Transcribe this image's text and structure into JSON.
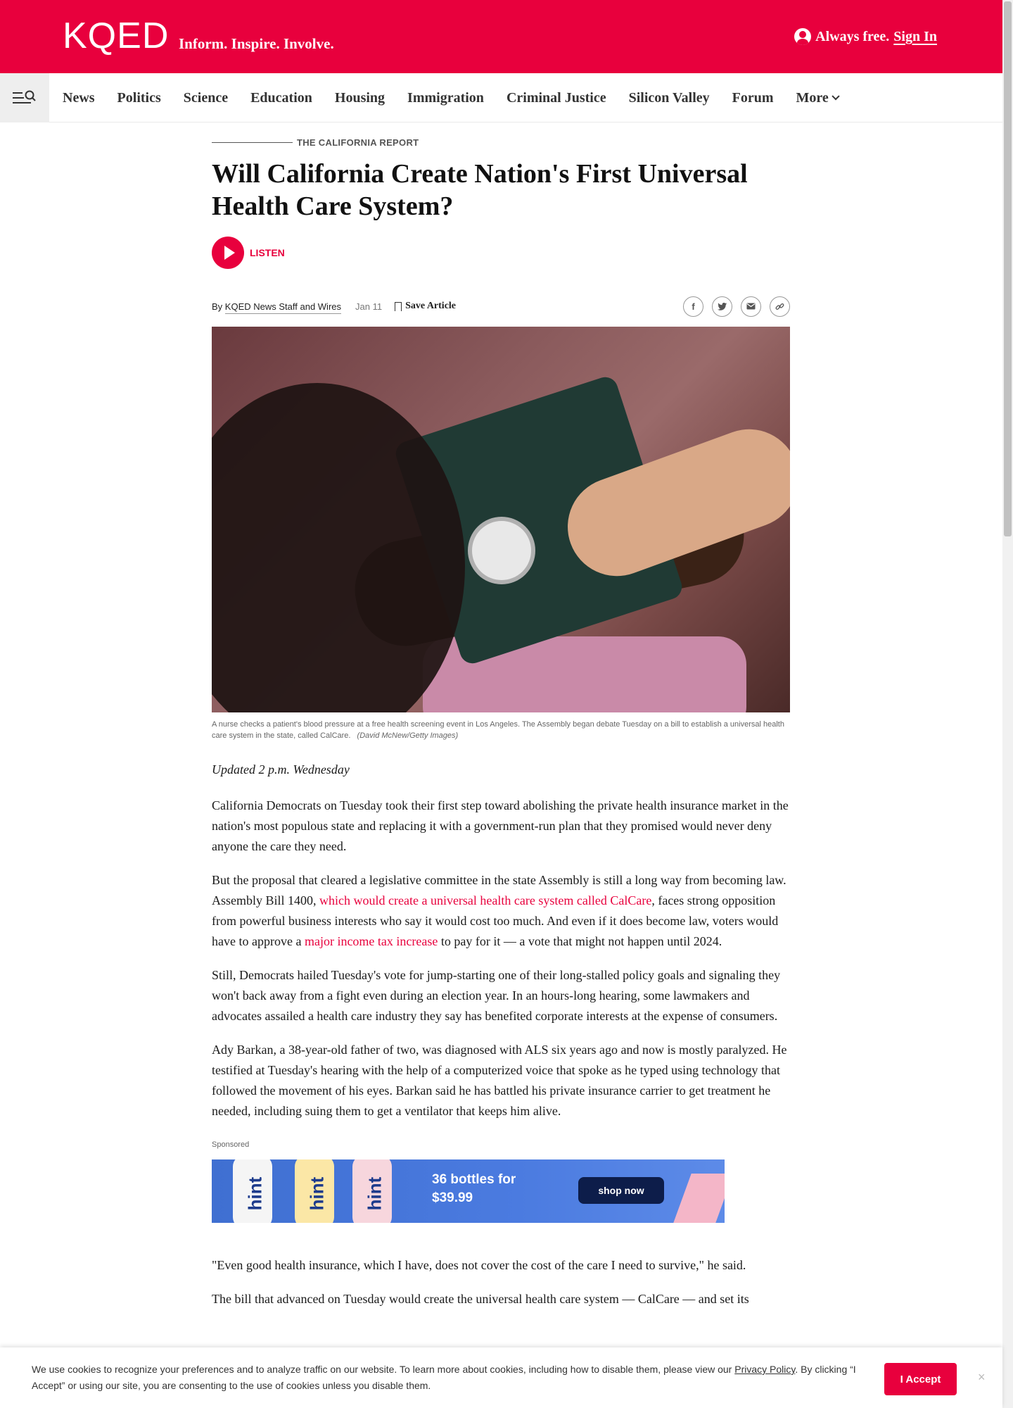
{
  "header": {
    "logo": "KQED",
    "tagline": "Inform. Inspire. Involve.",
    "always_free": "Always free.",
    "sign_in": "Sign In",
    "brand_color": "#e8003d"
  },
  "nav": {
    "items": [
      "News",
      "Politics",
      "Science",
      "Education",
      "Housing",
      "Immigration",
      "Criminal Justice",
      "Silicon Valley",
      "Forum",
      "More"
    ]
  },
  "article": {
    "kicker": "THE CALIFORNIA REPORT",
    "title": "Will California Create Nation's First Universal Health Care System?",
    "listen": "LISTEN",
    "by": "By",
    "author": "KQED News Staff and Wires",
    "date": "Jan 11",
    "save": "Save Article",
    "share_icons": [
      "facebook-icon",
      "twitter-icon",
      "email-icon",
      "link-icon"
    ],
    "caption": "A nurse checks a patient's blood pressure at a free health screening event in Los Angeles. The Assembly began debate Tuesday on a bill to establish a universal health care system in the state, called CalCare.",
    "credit": "(David McNew/Getty Images)",
    "updated": "Updated 2 p.m. Wednesday",
    "p1": "California Democrats on Tuesday took their first step toward abolishing the private health insurance market in the nation's most populous state and replacing it with a government-run plan that they promised would never deny anyone the care they need.",
    "p2_a": "But the proposal that cleared a legislative committee in the state Assembly is still a long way from becoming law. Assembly Bill 1400, ",
    "p2_link1": "which would create a universal health care system called CalCare",
    "p2_b": ", faces strong opposition from powerful business interests who say it would cost too much. And even if it does become law, voters would have to approve a ",
    "p2_link2": "major income tax increase",
    "p2_c": " to pay for it — a vote that might not happen until 2024.",
    "p3": "Still, Democrats hailed Tuesday's vote for jump-starting one of their long-stalled policy goals and signaling they won't back away from a fight even during an election year. In an hours-long hearing, some lawmakers and advocates assailed a health care industry they say has benefited corporate interests at the expense of consumers.",
    "p4": "Ady Barkan, a 38-year-old father of two, was diagnosed with ALS six years ago and now is mostly paralyzed. He testified at Tuesday's hearing with the help of a computerized voice that spoke as he typed using technology that followed the movement of his eyes. Barkan said he has battled his private insurance carrier to get treatment he needed, including suing them to get a ventilator that keeps him alive.",
    "p5": "\"Even good health insurance, which I have, does not cover the cost of the care I need to survive,\" he said.",
    "p6": "The bill that advanced on Tuesday would create the universal health care system — CalCare — and set its"
  },
  "ad": {
    "sponsored": "Sponsored",
    "brand": "hint",
    "promo_line1": "36 bottles for",
    "promo_line2": "$39.99",
    "cta": "shop now"
  },
  "cookie": {
    "text_a": "We use cookies to recognize your preferences and to analyze traffic on our website. To learn more about cookies, including how to disable them, please view our ",
    "policy": "Privacy Policy",
    "text_b": ". By clicking “I Accept” or using our site, you are consenting to the use of cookies unless you disable them.",
    "accept": "I Accept",
    "close": "×"
  }
}
